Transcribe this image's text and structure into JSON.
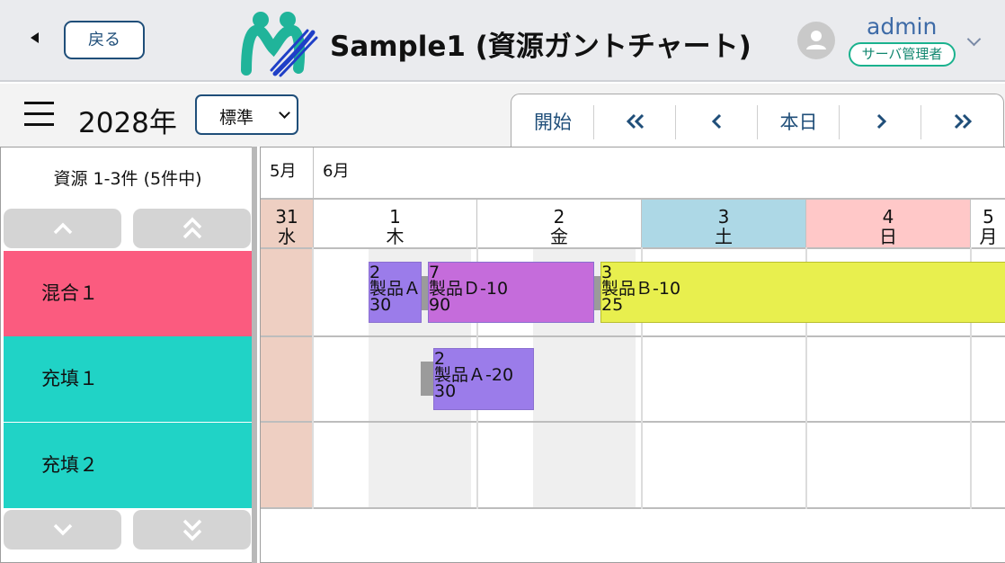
{
  "header": {
    "back_label": "戻る",
    "app_title": "Sample1 (資源ガントチャート)",
    "user_name": "admin",
    "user_role": "サーバ管理者",
    "colors": {
      "brand_teal": "#20b49a",
      "brand_blue": "#1f3fc7",
      "accent": "#1f4e79"
    }
  },
  "toolbar": {
    "year": "2028年",
    "view_select": "標準",
    "nav": {
      "start": "開始",
      "today": "本日",
      "first_glyph": "«",
      "prev_glyph": "‹",
      "next_glyph": "›",
      "last_glyph": "»"
    }
  },
  "resources": {
    "count_label": "資源 1-3件 (5件中)",
    "rows": [
      {
        "name": "混合１",
        "color": "#fb5b7f"
      },
      {
        "name": "充填１",
        "color": "#20d3c6"
      },
      {
        "name": "充填２",
        "color": "#20d3c6"
      }
    ]
  },
  "timeline": {
    "months": [
      "5月",
      "6月"
    ],
    "days": [
      {
        "num": "31",
        "dow": "水",
        "color": "#eecfc2"
      },
      {
        "num": "1",
        "dow": "木",
        "color": "#ffffff"
      },
      {
        "num": "2",
        "dow": "金",
        "color": "#ffffff"
      },
      {
        "num": "3",
        "dow": "土",
        "color": "#add8e6"
      },
      {
        "num": "4",
        "dow": "日",
        "color": "#ffc8c8"
      },
      {
        "num": "5",
        "dow": "月",
        "color": "#ffffff"
      }
    ]
  },
  "tasks": [
    {
      "id": "2",
      "product": "製品Ａ",
      "qty": "30",
      "color": "#9b7cea"
    },
    {
      "id": "7",
      "product": "製品Ｄ-10",
      "qty": "90",
      "color": "#c56cdb"
    },
    {
      "id": "3",
      "product": "製品Ｂ-10",
      "qty": "25",
      "color": "#e8ef4e"
    },
    {
      "id": "2",
      "product": "製品Ａ-20",
      "qty": "30",
      "color": "#9b7cea"
    }
  ]
}
